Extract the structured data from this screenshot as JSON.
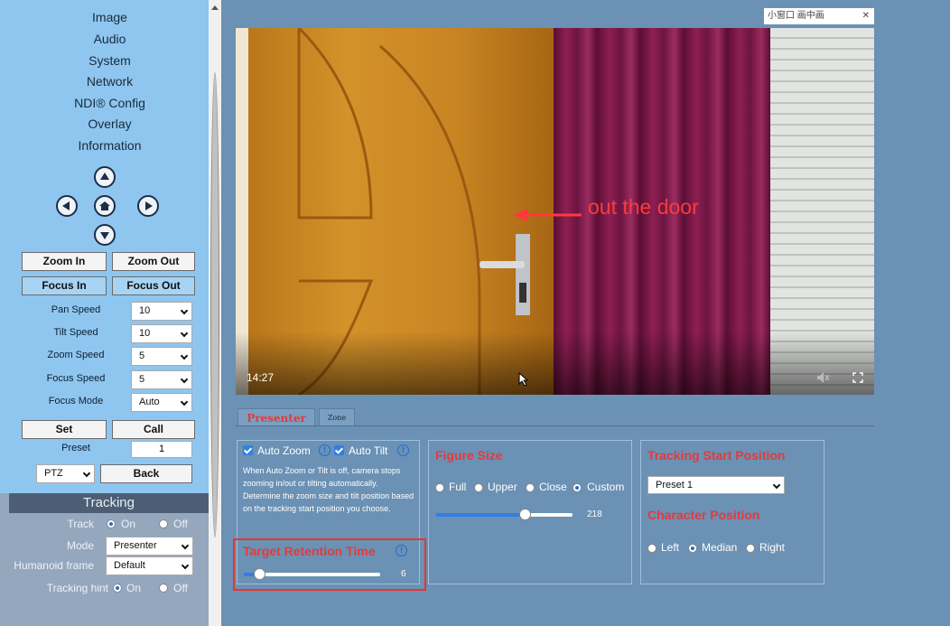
{
  "sidebar": {
    "menu": [
      "Image",
      "Audio",
      "System",
      "Network",
      "NDI® Config",
      "Overlay",
      "Information"
    ],
    "ptz_buttons": {
      "zoom_in": "Zoom In",
      "zoom_out": "Zoom Out",
      "focus_in": "Focus In",
      "focus_out": "Focus Out"
    },
    "settings": [
      {
        "label": "Pan Speed",
        "value": "10"
      },
      {
        "label": "Tilt Speed",
        "value": "10"
      },
      {
        "label": "Zoom Speed",
        "value": "5"
      },
      {
        "label": "Focus Speed",
        "value": "5"
      },
      {
        "label": "Focus Mode",
        "value": "Auto"
      }
    ],
    "preset": {
      "set_label": "Set",
      "call_label": "Call",
      "preset_label": "Preset",
      "preset_value": "1",
      "ptz_value": "PTZ",
      "back_label": "Back"
    },
    "tracking": {
      "title": "Tracking",
      "track_label": "Track",
      "track_on": "On",
      "track_off": "Off",
      "mode_label": "Mode",
      "mode_value": "Presenter",
      "frame_label": "Humanoid frame",
      "frame_value": "Default",
      "hint_label": "Tracking hint",
      "hint_on": "On",
      "hint_off": "Off"
    }
  },
  "video": {
    "timestamp": "14:27",
    "annotation": "out the door",
    "overlay_bar": "小窗口  画中画"
  },
  "tabs": [
    "Presenter",
    "Zone"
  ],
  "auto_panel": {
    "auto_zoom": "Auto Zoom",
    "auto_tilt": "Auto Tilt",
    "description": "When Auto Zoom or Tilt is off, camera stops zooming in/out or tilting automatically. Determine the zoom size and tilt position based on the tracking start position you choose.",
    "retention_title": "Target Retention Time",
    "retention_value": "6",
    "retention_fraction": 0.12
  },
  "figure_panel": {
    "title": "Figure Size",
    "options": [
      "Full",
      "Upper",
      "Close",
      "Custom"
    ],
    "selected": "Custom",
    "slider_value": "218",
    "slider_fraction": 0.65
  },
  "position_panel": {
    "start_title": "Tracking Start Position",
    "start_value": "Preset 1",
    "char_title": "Character Position",
    "options": [
      "Left",
      "Median",
      "Right"
    ],
    "selected": "Median"
  },
  "colors": {
    "accent": "#e23b3b",
    "highlight_box": "#e8352f",
    "radio_blue": "#1a6ed8"
  }
}
